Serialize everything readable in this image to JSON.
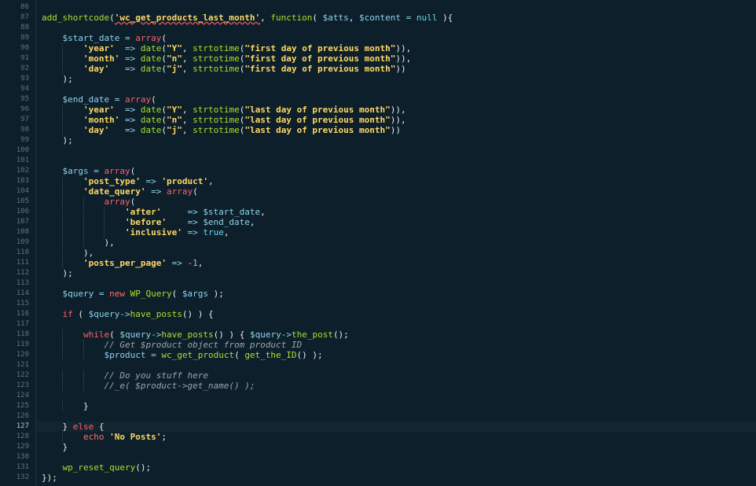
{
  "editor": {
    "current_line": 127,
    "lines": [
      {
        "n": "86",
        "t": []
      },
      {
        "n": "87",
        "t": [
          [
            "fn",
            "add_shortcode"
          ],
          [
            "pun",
            "("
          ],
          [
            "str",
            "'wc_get_products_last_month'"
          ],
          [
            "pun",
            ", "
          ],
          [
            "fn",
            "function"
          ],
          [
            "pun",
            "( "
          ],
          [
            "var",
            "$atts"
          ],
          [
            "pun",
            ", "
          ],
          [
            "var",
            "$content"
          ],
          [
            "op",
            " = "
          ],
          [
            "bool",
            "null"
          ],
          [
            "pun",
            " ){"
          ]
        ]
      },
      {
        "n": "88",
        "t": []
      },
      {
        "n": "89",
        "t": [
          [
            "sp",
            "    "
          ],
          [
            "var",
            "$start_date"
          ],
          [
            "op",
            " = "
          ],
          [
            "kw",
            "array"
          ],
          [
            "pun",
            "("
          ]
        ]
      },
      {
        "n": "90",
        "t": [
          [
            "sp",
            "        "
          ],
          [
            "str",
            "'year'"
          ],
          [
            "op",
            "  => "
          ],
          [
            "fn",
            "date"
          ],
          [
            "pun",
            "("
          ],
          [
            "str",
            "\"Y\""
          ],
          [
            "pun",
            ", "
          ],
          [
            "fn",
            "strtotime"
          ],
          [
            "pun",
            "("
          ],
          [
            "str",
            "\"first day of previous month\""
          ],
          [
            "pun",
            ")),"
          ]
        ]
      },
      {
        "n": "91",
        "t": [
          [
            "sp",
            "        "
          ],
          [
            "str",
            "'month'"
          ],
          [
            "op",
            " => "
          ],
          [
            "fn",
            "date"
          ],
          [
            "pun",
            "("
          ],
          [
            "str",
            "\"n\""
          ],
          [
            "pun",
            ", "
          ],
          [
            "fn",
            "strtotime"
          ],
          [
            "pun",
            "("
          ],
          [
            "str",
            "\"first day of previous month\""
          ],
          [
            "pun",
            ")),"
          ]
        ]
      },
      {
        "n": "92",
        "t": [
          [
            "sp",
            "        "
          ],
          [
            "str",
            "'day'"
          ],
          [
            "op",
            "   => "
          ],
          [
            "fn",
            "date"
          ],
          [
            "pun",
            "("
          ],
          [
            "str",
            "\"j\""
          ],
          [
            "pun",
            ", "
          ],
          [
            "fn",
            "strtotime"
          ],
          [
            "pun",
            "("
          ],
          [
            "str",
            "\"first day of previous month\""
          ],
          [
            "pun",
            "))"
          ]
        ]
      },
      {
        "n": "93",
        "t": [
          [
            "sp",
            "    "
          ],
          [
            "pun",
            ");"
          ]
        ]
      },
      {
        "n": "94",
        "t": []
      },
      {
        "n": "95",
        "t": [
          [
            "sp",
            "    "
          ],
          [
            "var",
            "$end_date"
          ],
          [
            "op",
            " = "
          ],
          [
            "kw",
            "array"
          ],
          [
            "pun",
            "("
          ]
        ]
      },
      {
        "n": "96",
        "t": [
          [
            "sp",
            "        "
          ],
          [
            "str",
            "'year'"
          ],
          [
            "op",
            "  => "
          ],
          [
            "fn",
            "date"
          ],
          [
            "pun",
            "("
          ],
          [
            "str",
            "\"Y\""
          ],
          [
            "pun",
            ", "
          ],
          [
            "fn",
            "strtotime"
          ],
          [
            "pun",
            "("
          ],
          [
            "str",
            "\"last day of previous month\""
          ],
          [
            "pun",
            ")),"
          ]
        ]
      },
      {
        "n": "97",
        "t": [
          [
            "sp",
            "        "
          ],
          [
            "str",
            "'month'"
          ],
          [
            "op",
            " => "
          ],
          [
            "fn",
            "date"
          ],
          [
            "pun",
            "("
          ],
          [
            "str",
            "\"n\""
          ],
          [
            "pun",
            ", "
          ],
          [
            "fn",
            "strtotime"
          ],
          [
            "pun",
            "("
          ],
          [
            "str",
            "\"last day of previous month\""
          ],
          [
            "pun",
            ")),"
          ]
        ]
      },
      {
        "n": "98",
        "t": [
          [
            "sp",
            "        "
          ],
          [
            "str",
            "'day'"
          ],
          [
            "op",
            "   => "
          ],
          [
            "fn",
            "date"
          ],
          [
            "pun",
            "("
          ],
          [
            "str",
            "\"j\""
          ],
          [
            "pun",
            ", "
          ],
          [
            "fn",
            "strtotime"
          ],
          [
            "pun",
            "("
          ],
          [
            "str",
            "\"last day of previous month\""
          ],
          [
            "pun",
            "))"
          ]
        ]
      },
      {
        "n": "99",
        "t": [
          [
            "sp",
            "    "
          ],
          [
            "pun",
            ");"
          ]
        ]
      },
      {
        "n": "100",
        "t": []
      },
      {
        "n": "101",
        "t": []
      },
      {
        "n": "102",
        "t": [
          [
            "sp",
            "    "
          ],
          [
            "var",
            "$args"
          ],
          [
            "op",
            " = "
          ],
          [
            "kw",
            "array"
          ],
          [
            "pun",
            "("
          ]
        ]
      },
      {
        "n": "103",
        "t": [
          [
            "sp",
            "        "
          ],
          [
            "str",
            "'post_type'"
          ],
          [
            "op",
            " => "
          ],
          [
            "str",
            "'product'"
          ],
          [
            "pun",
            ","
          ]
        ]
      },
      {
        "n": "104",
        "t": [
          [
            "sp",
            "        "
          ],
          [
            "str",
            "'date_query'"
          ],
          [
            "op",
            " => "
          ],
          [
            "kw",
            "array"
          ],
          [
            "pun",
            "("
          ]
        ]
      },
      {
        "n": "105",
        "t": [
          [
            "sp",
            "            "
          ],
          [
            "kw",
            "array"
          ],
          [
            "pun",
            "("
          ]
        ]
      },
      {
        "n": "106",
        "t": [
          [
            "sp",
            "                "
          ],
          [
            "str",
            "'after'"
          ],
          [
            "op",
            "     => "
          ],
          [
            "var",
            "$start_date"
          ],
          [
            "pun",
            ","
          ]
        ]
      },
      {
        "n": "107",
        "t": [
          [
            "sp",
            "                "
          ],
          [
            "str",
            "'before'"
          ],
          [
            "op",
            "    => "
          ],
          [
            "var",
            "$end_date"
          ],
          [
            "pun",
            ","
          ]
        ]
      },
      {
        "n": "108",
        "t": [
          [
            "sp",
            "                "
          ],
          [
            "str",
            "'inclusive'"
          ],
          [
            "op",
            " => "
          ],
          [
            "bool",
            "true"
          ],
          [
            "pun",
            ","
          ]
        ]
      },
      {
        "n": "109",
        "t": [
          [
            "sp",
            "            "
          ],
          [
            "pun",
            "),"
          ]
        ]
      },
      {
        "n": "110",
        "t": [
          [
            "sp",
            "        "
          ],
          [
            "pun",
            "),"
          ]
        ]
      },
      {
        "n": "111",
        "t": [
          [
            "sp",
            "        "
          ],
          [
            "str",
            "'posts_per_page'"
          ],
          [
            "op",
            " => "
          ],
          [
            "num",
            "-1"
          ],
          [
            "pun",
            ","
          ]
        ]
      },
      {
        "n": "112",
        "t": [
          [
            "sp",
            "    "
          ],
          [
            "pun",
            ");"
          ]
        ]
      },
      {
        "n": "113",
        "t": []
      },
      {
        "n": "114",
        "t": [
          [
            "sp",
            "    "
          ],
          [
            "var",
            "$query"
          ],
          [
            "op",
            " = "
          ],
          [
            "kw2",
            "new "
          ],
          [
            "fn",
            "WP_Query"
          ],
          [
            "pun",
            "( "
          ],
          [
            "var",
            "$args"
          ],
          [
            "pun",
            " );"
          ]
        ]
      },
      {
        "n": "115",
        "t": []
      },
      {
        "n": "116",
        "t": [
          [
            "sp",
            "    "
          ],
          [
            "kw",
            "if"
          ],
          [
            "pun",
            " ( "
          ],
          [
            "var",
            "$query"
          ],
          [
            "op",
            "->"
          ],
          [
            "fn",
            "have_posts"
          ],
          [
            "pun",
            "() ) {"
          ]
        ]
      },
      {
        "n": "117",
        "t": []
      },
      {
        "n": "118",
        "t": [
          [
            "sp",
            "        "
          ],
          [
            "kw",
            "while"
          ],
          [
            "pun",
            "( "
          ],
          [
            "var",
            "$query"
          ],
          [
            "op",
            "->"
          ],
          [
            "fn",
            "have_posts"
          ],
          [
            "pun",
            "() ) { "
          ],
          [
            "var",
            "$query"
          ],
          [
            "op",
            "->"
          ],
          [
            "fn",
            "the_post"
          ],
          [
            "pun",
            "();"
          ]
        ]
      },
      {
        "n": "119",
        "t": [
          [
            "sp",
            "            "
          ],
          [
            "cmt",
            "// Get $product object from product ID"
          ]
        ]
      },
      {
        "n": "120",
        "t": [
          [
            "sp",
            "            "
          ],
          [
            "var",
            "$product"
          ],
          [
            "op",
            " = "
          ],
          [
            "fn",
            "wc_get_product"
          ],
          [
            "pun",
            "( "
          ],
          [
            "fn",
            "get_the_ID"
          ],
          [
            "pun",
            "() );"
          ]
        ]
      },
      {
        "n": "121",
        "t": []
      },
      {
        "n": "122",
        "t": [
          [
            "sp",
            "            "
          ],
          [
            "cmt",
            "// Do you stuff here"
          ]
        ]
      },
      {
        "n": "123",
        "t": [
          [
            "sp",
            "            "
          ],
          [
            "cmt",
            "//_e( $product->get_name() );"
          ]
        ]
      },
      {
        "n": "124",
        "t": []
      },
      {
        "n": "125",
        "t": [
          [
            "sp",
            "        "
          ],
          [
            "pun",
            "}"
          ]
        ]
      },
      {
        "n": "126",
        "t": []
      },
      {
        "n": "127",
        "t": [
          [
            "sp",
            "    "
          ],
          [
            "pun",
            "} "
          ],
          [
            "kw",
            "else"
          ],
          [
            "pun",
            " {"
          ]
        ]
      },
      {
        "n": "128",
        "t": [
          [
            "sp",
            "        "
          ],
          [
            "kw2",
            "echo "
          ],
          [
            "str",
            "'No Posts'"
          ],
          [
            "pun",
            ";"
          ]
        ]
      },
      {
        "n": "129",
        "t": [
          [
            "sp",
            "    "
          ],
          [
            "pun",
            "}"
          ]
        ]
      },
      {
        "n": "130",
        "t": []
      },
      {
        "n": "131",
        "t": [
          [
            "sp",
            "    "
          ],
          [
            "fn",
            "wp_reset_query"
          ],
          [
            "pun",
            "();"
          ]
        ]
      },
      {
        "n": "132",
        "t": [
          [
            "pun",
            "});"
          ]
        ]
      }
    ]
  }
}
